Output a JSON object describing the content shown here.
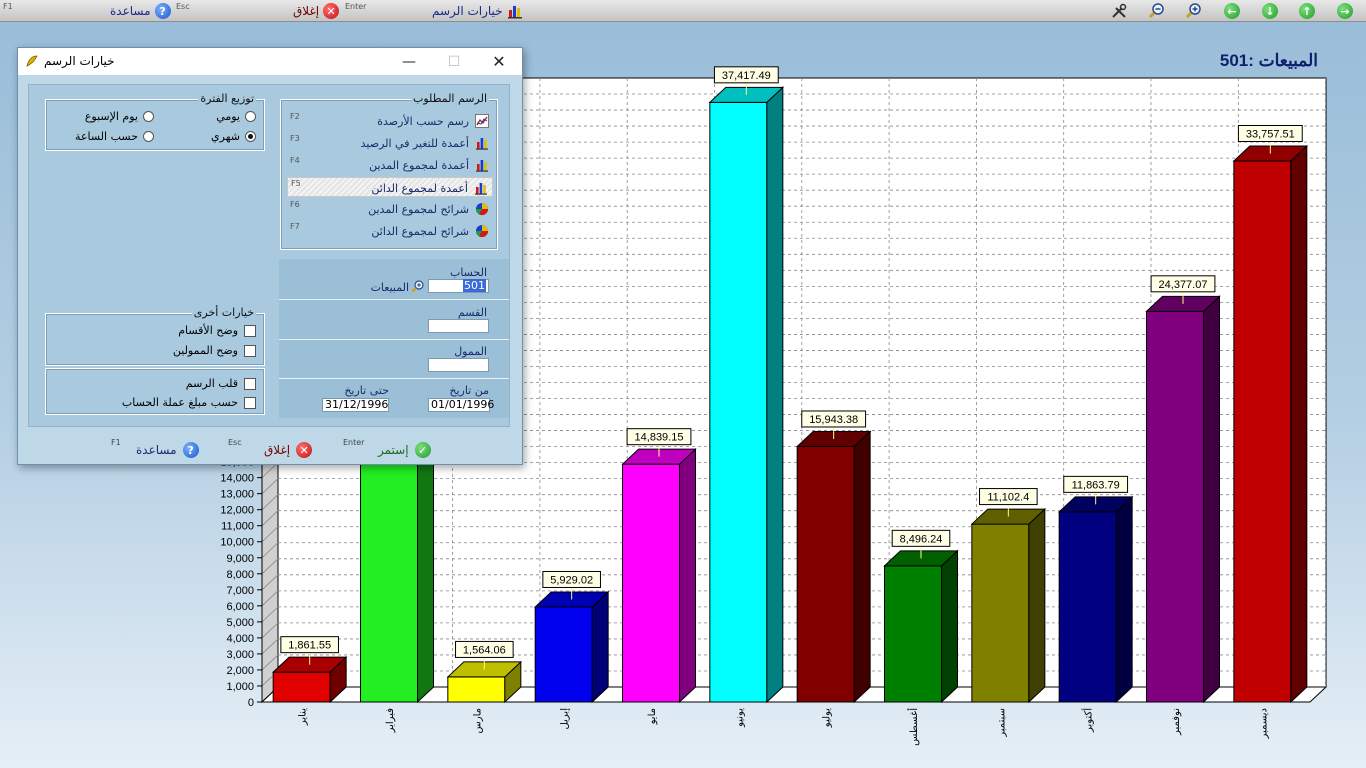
{
  "toolbar": {
    "help_label": "مساعدة",
    "help_key": "F1",
    "close_label": "إغلاق",
    "close_key": "Esc",
    "options_label": "خيارات الرسم",
    "options_key": "Enter"
  },
  "chart_title": "المبيعات :501",
  "chart_data": {
    "type": "bar",
    "categories": [
      "يناير",
      "فبراير",
      "مارس",
      "إبريل",
      "مايو",
      "يونيو",
      "يوليو",
      "أغسطس",
      "سبتمبر",
      "أكتوبر",
      "نوفمبر",
      "ديسمبر"
    ],
    "values": [
      1861.55,
      null,
      1564.06,
      5929.02,
      14839.15,
      37417.49,
      15943.38,
      8496.24,
      11102.4,
      11863.79,
      24377.07,
      33757.51
    ],
    "labels": [
      "1,861.55",
      "",
      "1,564.06",
      "5,929.02",
      "14,839.15",
      "37,417.49",
      "15,943.38",
      "8,496.24",
      "11,102.4",
      "11,863.79",
      "24,377.07",
      "33,757.51"
    ],
    "colors": [
      "#e00000",
      "#22ee22",
      "#ffff00",
      "#0000ee",
      "#ff00ff",
      "#00ffff",
      "#800000",
      "#008000",
      "#808000",
      "#000080",
      "#800080",
      "#c00000"
    ],
    "yticks_visible": [
      "0",
      "1,000",
      "2,000",
      "3,000",
      "4,000",
      "5,000",
      "6,000",
      "7,000",
      "8,000",
      "9,000",
      "10,000",
      "11,000",
      "12,000",
      "13,000",
      "14,000",
      "15,000"
    ],
    "ylim": [
      0,
      38000
    ],
    "grid": true
  },
  "dialog": {
    "title": "خيارات الرسم",
    "required_chart_legend": "الرسم المطلوب",
    "options": [
      {
        "key": "F2",
        "label": "رسم حسب الأرصدة",
        "icon": "line-chart-icon"
      },
      {
        "key": "F3",
        "label": "أعمدة للتغير في الرصيد",
        "icon": "bar-chart-icon"
      },
      {
        "key": "F4",
        "label": "أعمدة لمجموع المدين",
        "icon": "bar-chart-icon"
      },
      {
        "key": "F5",
        "label": "أعمدة لمجموع الدائن",
        "icon": "bar-chart-icon"
      },
      {
        "key": "F6",
        "label": "شرائح لمجموع المدين",
        "icon": "pie-chart-icon"
      },
      {
        "key": "F7",
        "label": "شرائح لمجموع الدائن",
        "icon": "pie-chart-icon"
      }
    ],
    "period_legend": "توزيع الفترة",
    "period": {
      "daily": "يومي",
      "weekday": "يوم الإسبوع",
      "monthly": "شهري",
      "hourly": "حسب الساعة"
    },
    "account_label": "الحساب",
    "account_value": "501",
    "account_name": "المبيعات",
    "department_label": "القسم",
    "financier_label": "الممول",
    "from_date_label": "من تاريخ",
    "from_date": "01/01/1996",
    "to_date_label": "حتى تاريخ",
    "to_date": "31/12/1996",
    "other_legend": "خيارات أخرى",
    "show_departments": "وضح الأقسام",
    "show_financiers": "وضح الممولين",
    "flip_chart": "قلب الرسم",
    "by_currency": "حسب مبلغ عملة الحساب",
    "continue_label": "إستمر",
    "continue_key": "Enter",
    "close_label": "إغلاق",
    "close_key": "Esc",
    "help_label": "مساعدة",
    "help_key": "F1"
  }
}
